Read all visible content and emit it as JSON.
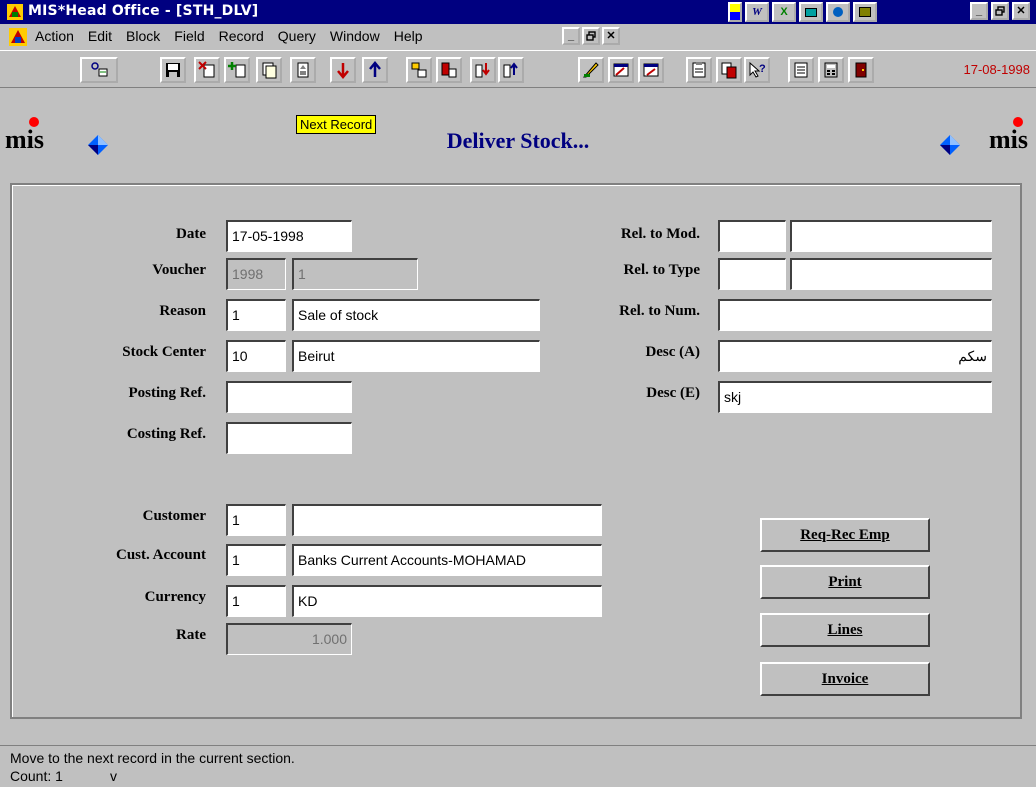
{
  "window": {
    "title": "MIS*Head Office - [STH_DLV]",
    "minimize": "_",
    "restore": "Ѧ",
    "close": "✕"
  },
  "menu": {
    "items": [
      {
        "label": "Action",
        "key": "A"
      },
      {
        "label": "Edit",
        "key": "E"
      },
      {
        "label": "Block",
        "key": "B"
      },
      {
        "label": "Field",
        "key": "F"
      },
      {
        "label": "Record",
        "key": "R"
      },
      {
        "label": "Query",
        "key": "Q"
      },
      {
        "label": "Window",
        "key": "W"
      },
      {
        "label": "Help",
        "key": "H"
      }
    ]
  },
  "toolbar": {
    "date": "17-08-1998",
    "tooltip": "Next Record",
    "icons": [
      "query-icon",
      "save-icon",
      "delete-record-icon",
      "insert-record-icon",
      "duplicate-icon",
      "next-record-icon",
      "previous-record-icon",
      "next-block-icon",
      "previous-block-icon",
      "enter-query-icon",
      "execute-query-icon",
      "edit-icon",
      "list-values-icon",
      "clear-icon",
      "copy-icon",
      "paste-icon",
      "help-icon",
      "print-icon",
      "calculator-icon",
      "exit-icon"
    ]
  },
  "header": {
    "form_title": "Deliver Stock...",
    "logo_text": "mis"
  },
  "form": {
    "labels": {
      "date": "Date",
      "voucher": "Voucher",
      "reason": "Reason",
      "stock_center": "Stock Center",
      "posting_ref": "Posting Ref.",
      "costing_ref": "Costing Ref.",
      "rel_mod": "Rel. to Mod.",
      "rel_type": "Rel. to Type",
      "rel_num": "Rel. to Num.",
      "desc_a": "Desc (A)",
      "desc_e": "Desc (E)",
      "customer": "Customer",
      "cust_account": "Cust. Account",
      "currency": "Currency",
      "rate": "Rate"
    },
    "values": {
      "date": "17-05-1998",
      "voucher_year": "1998",
      "voucher_num": "1",
      "reason_code": "1",
      "reason_name": "Sale of stock",
      "stock_center_code": "10",
      "stock_center_name": "Beirut",
      "posting_ref": "",
      "costing_ref": "",
      "rel_mod_1": "",
      "rel_mod_2": "",
      "rel_type_1": "",
      "rel_type_2": "",
      "rel_num": "",
      "desc_a": "سكم",
      "desc_e": "skj",
      "customer_code": "1",
      "customer_name": "",
      "cust_account_code": "1",
      "cust_account_name": "Banks Current Accounts-MOHAMAD",
      "currency_code": "1",
      "currency_name": "KD",
      "rate": "1.000"
    },
    "buttons": {
      "req_rec_emp": {
        "label": "Req-Rec Emp",
        "key": "R"
      },
      "print": {
        "label": "Print",
        "key": "P"
      },
      "lines": {
        "label": "Lines",
        "key": "L"
      },
      "invoice": {
        "label": "Invoice",
        "key": "I"
      }
    }
  },
  "status": {
    "message": "Move to the next record in the current section.",
    "count": "Count: 1",
    "mode": "v"
  }
}
